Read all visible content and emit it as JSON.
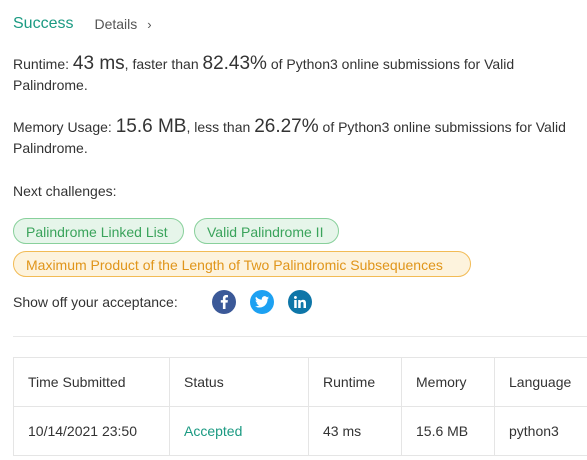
{
  "header": {
    "status": "Success",
    "details_label": "Details",
    "details_chevron": "›"
  },
  "runtime": {
    "label": "Runtime:",
    "value": "43 ms",
    "comparison": ", faster than",
    "percent": "82.43%",
    "suffix": "of Python3 online submissions for Valid Palindrome."
  },
  "memory": {
    "label": "Memory Usage:",
    "value": "15.6 MB",
    "comparison": ", less than",
    "percent": "26.27%",
    "suffix": "of Python3 online submissions for Valid Palindrome."
  },
  "next_challenges": {
    "label": "Next challenges:",
    "items": [
      {
        "title": "Palindrome Linked List",
        "difficulty": "easy"
      },
      {
        "title": "Valid Palindrome II",
        "difficulty": "easy"
      },
      {
        "title": "Maximum Product of the Length of Two Palindromic Subsequences",
        "difficulty": "medium"
      }
    ]
  },
  "share": {
    "label": "Show off your acceptance:",
    "icons": [
      "facebook-icon",
      "twitter-icon",
      "linkedin-icon"
    ],
    "colors": {
      "facebook": "#3b5998",
      "twitter": "#1da1f2",
      "linkedin": "#0e76a8"
    }
  },
  "submissions": {
    "columns": [
      "Time Submitted",
      "Status",
      "Runtime",
      "Memory",
      "Language"
    ],
    "rows": [
      {
        "time": "10/14/2021 23:50",
        "status": "Accepted",
        "runtime": "43 ms",
        "memory": "15.6 MB",
        "language": "python3"
      }
    ]
  },
  "colors": {
    "accent": "#1b9a82",
    "easy_text": "#3aa35b",
    "easy_bg": "#e6f5ea",
    "medium_text": "#e0951a",
    "medium_bg": "#fdf3dd"
  }
}
